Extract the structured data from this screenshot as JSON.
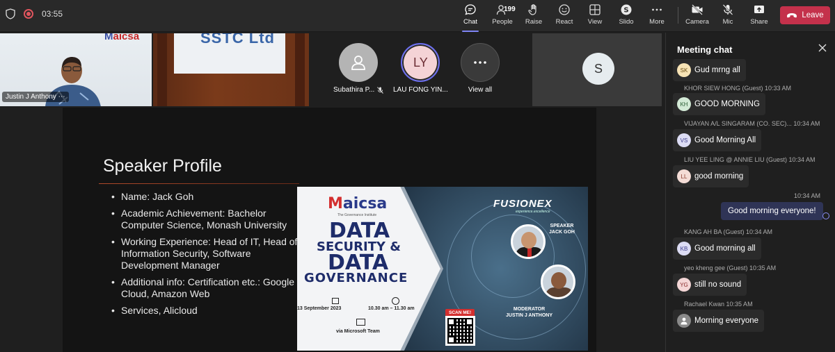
{
  "meeting": {
    "timer": "03:55"
  },
  "toolbar": {
    "chat_label": "Chat",
    "people_label": "People",
    "people_count": "199",
    "raise_label": "Raise",
    "react_label": "React",
    "view_label": "View",
    "slido_label": "Slido",
    "more_label": "More",
    "camera_label": "Camera",
    "mic_label": "Mic",
    "share_label": "Share",
    "leave_label": "Leave"
  },
  "participants": {
    "justin": {
      "name": "Justin J Anthony",
      "video_sign": "SSTC Ltd",
      "backdrop_logo": "aicsa"
    },
    "subathira": {
      "name": "Subathira P..."
    },
    "lau": {
      "initials": "LY",
      "name": "LAU FONG YIN..."
    },
    "view_all": {
      "label": "View all"
    },
    "s_tile": {
      "initials": "S"
    }
  },
  "slide": {
    "title": "Speaker Profile",
    "bullets": [
      "Name: Jack Goh",
      "Academic Achievement: Bachelor Computer Science, Monash University",
      "Working Experience: Head of IT, Head of Information Security, Software Development Manager",
      "Additional info: Certification etc.: Google Cloud, Amazon Web",
      "Services, Alicloud"
    ],
    "poster": {
      "maicsa": "aicsa",
      "institute": "The Governance Institute",
      "line1": "DATA",
      "line2": "SECURITY &",
      "line3": "DATA",
      "line4": "GOVERNANCE",
      "date": "13 September 2023",
      "time": "10.30 am – 11.30 am",
      "via": "via Microsoft Team",
      "fusionex": "FUSIONEX",
      "fusionex_tag": "experience.excellence",
      "speaker_role": "SPEAKER",
      "speaker_name": "JACK GOH",
      "moderator_role": "MODERATOR",
      "moderator_name": "JUSTIN J ANTHONY",
      "scan": "SCAN ME!"
    }
  },
  "chat": {
    "title": "Meeting chat",
    "messages": [
      {
        "initials": "SK",
        "avatar_bg": "#f7e3b5",
        "avatar_fg": "#6b4e12",
        "meta": "",
        "text": "Gud mrng all"
      },
      {
        "initials": "KH",
        "avatar_bg": "#d3ead6",
        "avatar_fg": "#2b5d34",
        "meta": "KHOR SIEW HONG (Guest)   10:33 AM",
        "text": "GOOD MORNING"
      },
      {
        "initials": "VS",
        "avatar_bg": "#dcdcf4",
        "avatar_fg": "#3c3c8a",
        "meta": "VIJAYAN A/L SINGARAM (CO. SEC)...   10:34 AM",
        "text": "Good Morning All"
      },
      {
        "initials": "LL",
        "avatar_bg": "#f4dcd6",
        "avatar_fg": "#8a3a2c",
        "meta": "LIU YEE LING @ ANNIE LIU (Guest)   10:34 AM",
        "text": "good morning"
      },
      {
        "initials": "KB",
        "avatar_bg": "#dcdcf4",
        "avatar_fg": "#3c3c8a",
        "meta": "KANG AH BA (Guest)   10:34 AM",
        "text": "Good morning all"
      },
      {
        "initials": "YG",
        "avatar_bg": "#f4d6d6",
        "avatar_fg": "#8a2c2c",
        "meta": "yeo kheng gee (Guest)   10:35 AM",
        "text": "still no sound"
      },
      {
        "initials": "",
        "avatar_bg": "#8a8a8a",
        "avatar_fg": "#ffffff",
        "meta": "Rachael Kwan   10:35 AM",
        "text": "Morning everyone"
      }
    ],
    "mine": {
      "time": "10:34 AM",
      "text": "Good morning everyone!"
    }
  }
}
